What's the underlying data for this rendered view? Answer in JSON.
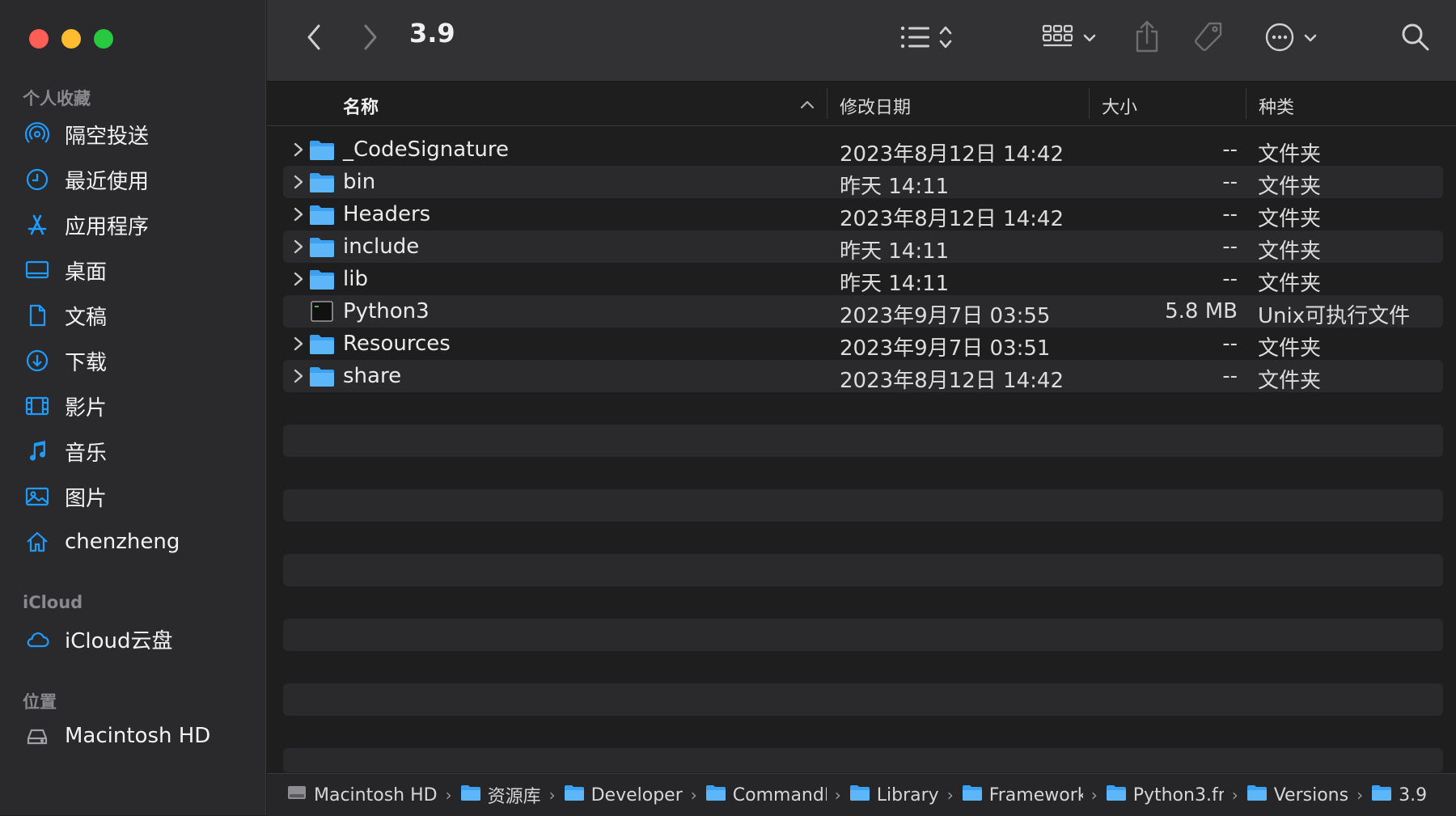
{
  "window": {
    "title": "3.9"
  },
  "sidebar": {
    "favorites_label": "个人收藏",
    "favorites": [
      {
        "label": "隔空投送",
        "icon": "airdrop-icon"
      },
      {
        "label": "最近使用",
        "icon": "clock-icon"
      },
      {
        "label": "应用程序",
        "icon": "applications-icon"
      },
      {
        "label": "桌面",
        "icon": "desktop-icon"
      },
      {
        "label": "文稿",
        "icon": "document-icon"
      },
      {
        "label": "下载",
        "icon": "download-icon"
      },
      {
        "label": "影片",
        "icon": "film-icon"
      },
      {
        "label": "音乐",
        "icon": "music-icon"
      },
      {
        "label": "图片",
        "icon": "photo-icon"
      },
      {
        "label": "chenzheng",
        "icon": "home-icon"
      }
    ],
    "icloud_label": "iCloud",
    "icloud": [
      {
        "label": "iCloud云盘",
        "icon": "cloud-icon"
      }
    ],
    "locations_label": "位置",
    "locations": [
      {
        "label": "Macintosh HD",
        "icon": "disk-icon"
      }
    ]
  },
  "columns": {
    "name": "名称",
    "modified": "修改日期",
    "size": "大小",
    "kind": "种类"
  },
  "files": [
    {
      "name": "_CodeSignature",
      "modified": "2023年8月12日 14:42",
      "size": "--",
      "kind": "文件夹",
      "type": "folder"
    },
    {
      "name": "bin",
      "modified": "昨天 14:11",
      "size": "--",
      "kind": "文件夹",
      "type": "folder"
    },
    {
      "name": "Headers",
      "modified": "2023年8月12日 14:42",
      "size": "--",
      "kind": "文件夹",
      "type": "folder"
    },
    {
      "name": "include",
      "modified": "昨天 14:11",
      "size": "--",
      "kind": "文件夹",
      "type": "folder"
    },
    {
      "name": "lib",
      "modified": "昨天 14:11",
      "size": "--",
      "kind": "文件夹",
      "type": "folder"
    },
    {
      "name": "Python3",
      "modified": "2023年9月7日 03:55",
      "size": "5.8 MB",
      "kind": "Unix可执行文件",
      "type": "executable"
    },
    {
      "name": "Resources",
      "modified": "2023年9月7日 03:51",
      "size": "--",
      "kind": "文件夹",
      "type": "folder"
    },
    {
      "name": "share",
      "modified": "2023年8月12日 14:42",
      "size": "--",
      "kind": "文件夹",
      "type": "folder"
    }
  ],
  "pathbar": [
    {
      "label": "Macintosh HD",
      "icon": "disk-icon"
    },
    {
      "label": "资源库",
      "icon": "folder-icon"
    },
    {
      "label": "Developer",
      "icon": "folder-icon"
    },
    {
      "label": "CommandL",
      "icon": "folder-icon"
    },
    {
      "label": "Library",
      "icon": "folder-icon"
    },
    {
      "label": "Framework",
      "icon": "folder-icon"
    },
    {
      "label": "Python3.fr",
      "icon": "folder-icon"
    },
    {
      "label": "Versions",
      "icon": "folder-icon"
    },
    {
      "label": "3.9",
      "icon": "folder-icon"
    }
  ],
  "colors": {
    "accent": "#1e9bff",
    "folder": "#3aa0ef",
    "sidebar_bg": "#2a2a2c",
    "window_bg": "#1e1e1e"
  }
}
